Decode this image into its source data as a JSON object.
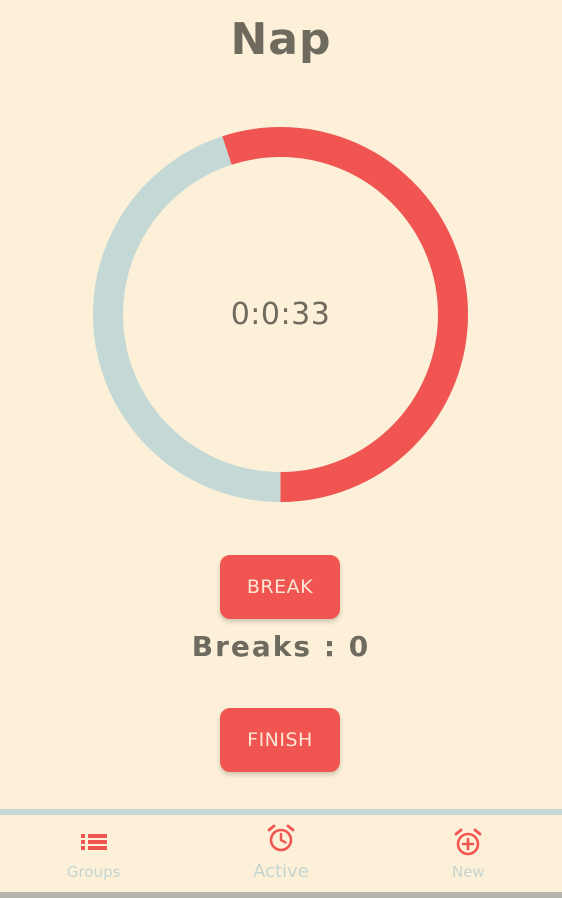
{
  "screen": {
    "title": "Nap"
  },
  "timer": {
    "display": "0:0:33",
    "progress_fraction": 0.55,
    "colors": {
      "elapsed": "#f15552",
      "remaining": "#c4d8d6"
    }
  },
  "actions": {
    "break_label": "BREAK",
    "breaks_text": "Breaks : 0",
    "finish_label": "FINISH"
  },
  "nav": {
    "items": [
      {
        "label": "Groups",
        "icon": "list-icon",
        "active": false
      },
      {
        "label": "Active",
        "icon": "alarm-clock-icon",
        "active": true
      },
      {
        "label": "New",
        "icon": "alarm-add-icon",
        "active": false
      }
    ]
  },
  "colors": {
    "background": "#fdf0d8",
    "accent": "#f15552",
    "muted": "#c4d8d6",
    "text": "#6e6a5e"
  }
}
